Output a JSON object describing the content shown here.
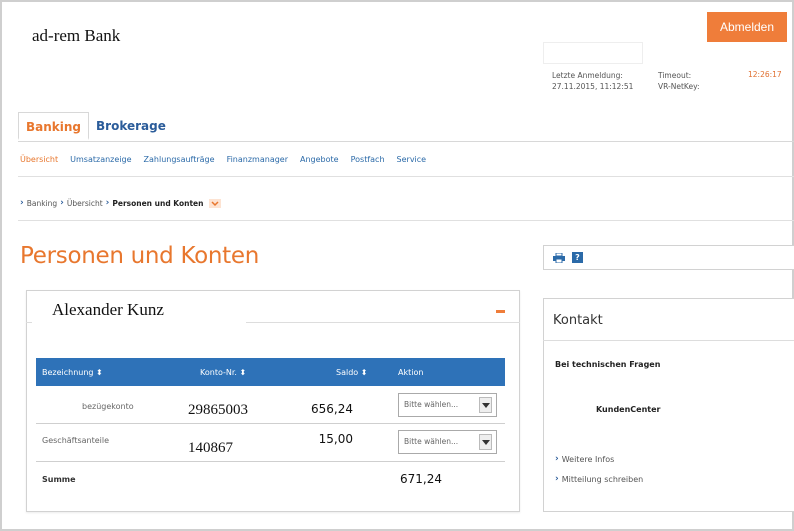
{
  "header": {
    "bank_name": "ad-rem Bank",
    "logout_label": "Abmelden",
    "last_login_label": "Letzte Anmeldung:",
    "last_login_value": "27.11.2015, 11:12:51",
    "timeout_label": "Timeout:",
    "vr_netkey_label": "VR-NetKey:",
    "timeout_value": "12:26:17"
  },
  "tabs": [
    {
      "label": "Banking",
      "active": true
    },
    {
      "label": "Brokerage",
      "active": false
    }
  ],
  "subnav": [
    "Übersicht",
    "Umsatzanzeige",
    "Zahlungsaufträge",
    "Finanzmanager",
    "Angebote",
    "Postfach",
    "Service"
  ],
  "breadcrumb": {
    "item1": "Banking",
    "item2": "Übersicht",
    "current": "Personen und Konten"
  },
  "page_title": "Personen und Konten",
  "account_panel": {
    "holder": "Alexander Kunz",
    "columns": [
      "Bezeichnung",
      "Konto-Nr.",
      "Saldo",
      "Aktion"
    ],
    "rows": [
      {
        "name": "bezügekonto",
        "account": "29865003",
        "saldo": "656,24",
        "action": "Bitte wählen..."
      },
      {
        "name": "Geschäftsanteile",
        "account": "140867",
        "saldo": "15,00",
        "action": "Bitte wählen..."
      }
    ],
    "sum_label": "Summe",
    "sum_value": "671,24"
  },
  "contact_panel": {
    "title": "Kontakt",
    "question": "Bei technischen Fragen",
    "center": "KundenCenter",
    "links": [
      "Weitere Infos",
      "Mitteilung schreiben"
    ]
  },
  "colors": {
    "accent": "#ef7d3a",
    "primary": "#2e72b8"
  }
}
